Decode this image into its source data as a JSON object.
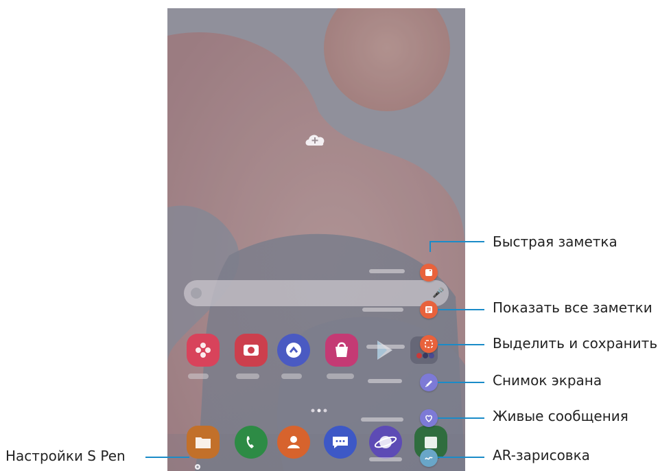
{
  "callouts": {
    "quick_note": "Быстрая заметка",
    "view_all_notes": "Показать все заметки",
    "smart_select": "Выделить и сохранить",
    "screen_write": "Снимок экрана",
    "live_messages": "Живые сообщения",
    "ar_doodle": "AR-зарисовка",
    "s_pen_settings": "Настройки S Pen"
  },
  "icons": {
    "cloud": "cloud-add-icon",
    "mic": "mic-icon",
    "quick_note": "note-add-icon",
    "view_all_notes": "notes-list-icon",
    "smart_select": "selection-icon",
    "screen_write": "pen-write-icon",
    "live_messages": "heart-icon",
    "ar_doodle": "ar-squiggle-icon",
    "settings": "gear-icon"
  },
  "colors": {
    "callout_line": "#1a8bc8",
    "fab_orange": "#e8623c",
    "fab_purple": "#7d7ad6",
    "fab_blue": "#69a6c8"
  }
}
